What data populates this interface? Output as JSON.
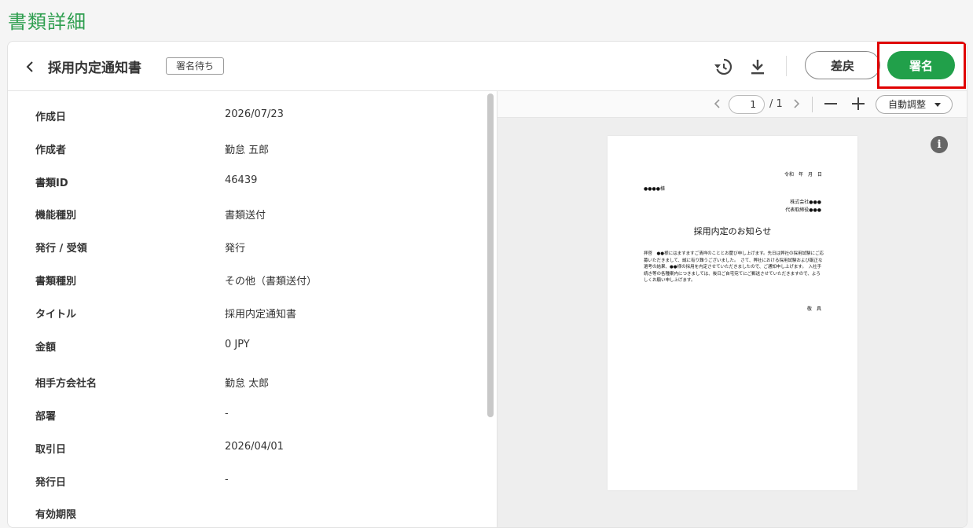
{
  "page_title": "書類詳細",
  "header": {
    "doc_title": "採用内定通知書",
    "status_badge": "署名待ち",
    "return_label": "差戻",
    "sign_label": "署名"
  },
  "details": [
    {
      "label": "作成日",
      "value": "2026/07/23"
    },
    {
      "label": "作成者",
      "value": "勤怠 五郎"
    },
    {
      "label": "書類ID",
      "value": "46439"
    },
    {
      "label": "機能種別",
      "value": "書類送付"
    },
    {
      "label": "発行 / 受領",
      "value": "発行"
    },
    {
      "label": "書類種別",
      "value": "その他（書類送付）"
    },
    {
      "label": "タイトル",
      "value": "採用内定通知書"
    },
    {
      "label": "金額",
      "value": "0 JPY"
    },
    {
      "label": "相手方会社名",
      "value": "勤怠 太郎"
    },
    {
      "label": "部署",
      "value": "-"
    },
    {
      "label": "取引日",
      "value": "2026/04/01"
    },
    {
      "label": "発行日",
      "value": "-"
    },
    {
      "label": "有効期限",
      "value": ""
    }
  ],
  "viewer": {
    "page_current": "1",
    "page_total": "/ 1",
    "zoom_label": "自動調整",
    "info_glyph": "i"
  },
  "document": {
    "date_line": "令和　年　月　日",
    "recipient": "●●●●様",
    "sender_company": "株式会社●●●",
    "sender_rep": "代表取締役●●●",
    "title": "採用内定のお知らせ",
    "body": "拝啓　●●様にはますますご清祥のこととお慶び申し上げます。先日は弊社の採用試験にご応募いただきまして、誠に有り難うございました。　さて、弊社における採用試験および厳正な選考の結果、●●様の採用を内定させていただきましたので、ご通知申し上げます。　入社手続き等の各種案内につきましては、後日ご自宅宛てにご郵送させていただきますので、よろしくお願い申し上げます。",
    "closing": "敬　具"
  },
  "colors": {
    "brand_green": "#21a04a",
    "title_green": "#2e9e4f",
    "highlight_red": "#e00000"
  }
}
